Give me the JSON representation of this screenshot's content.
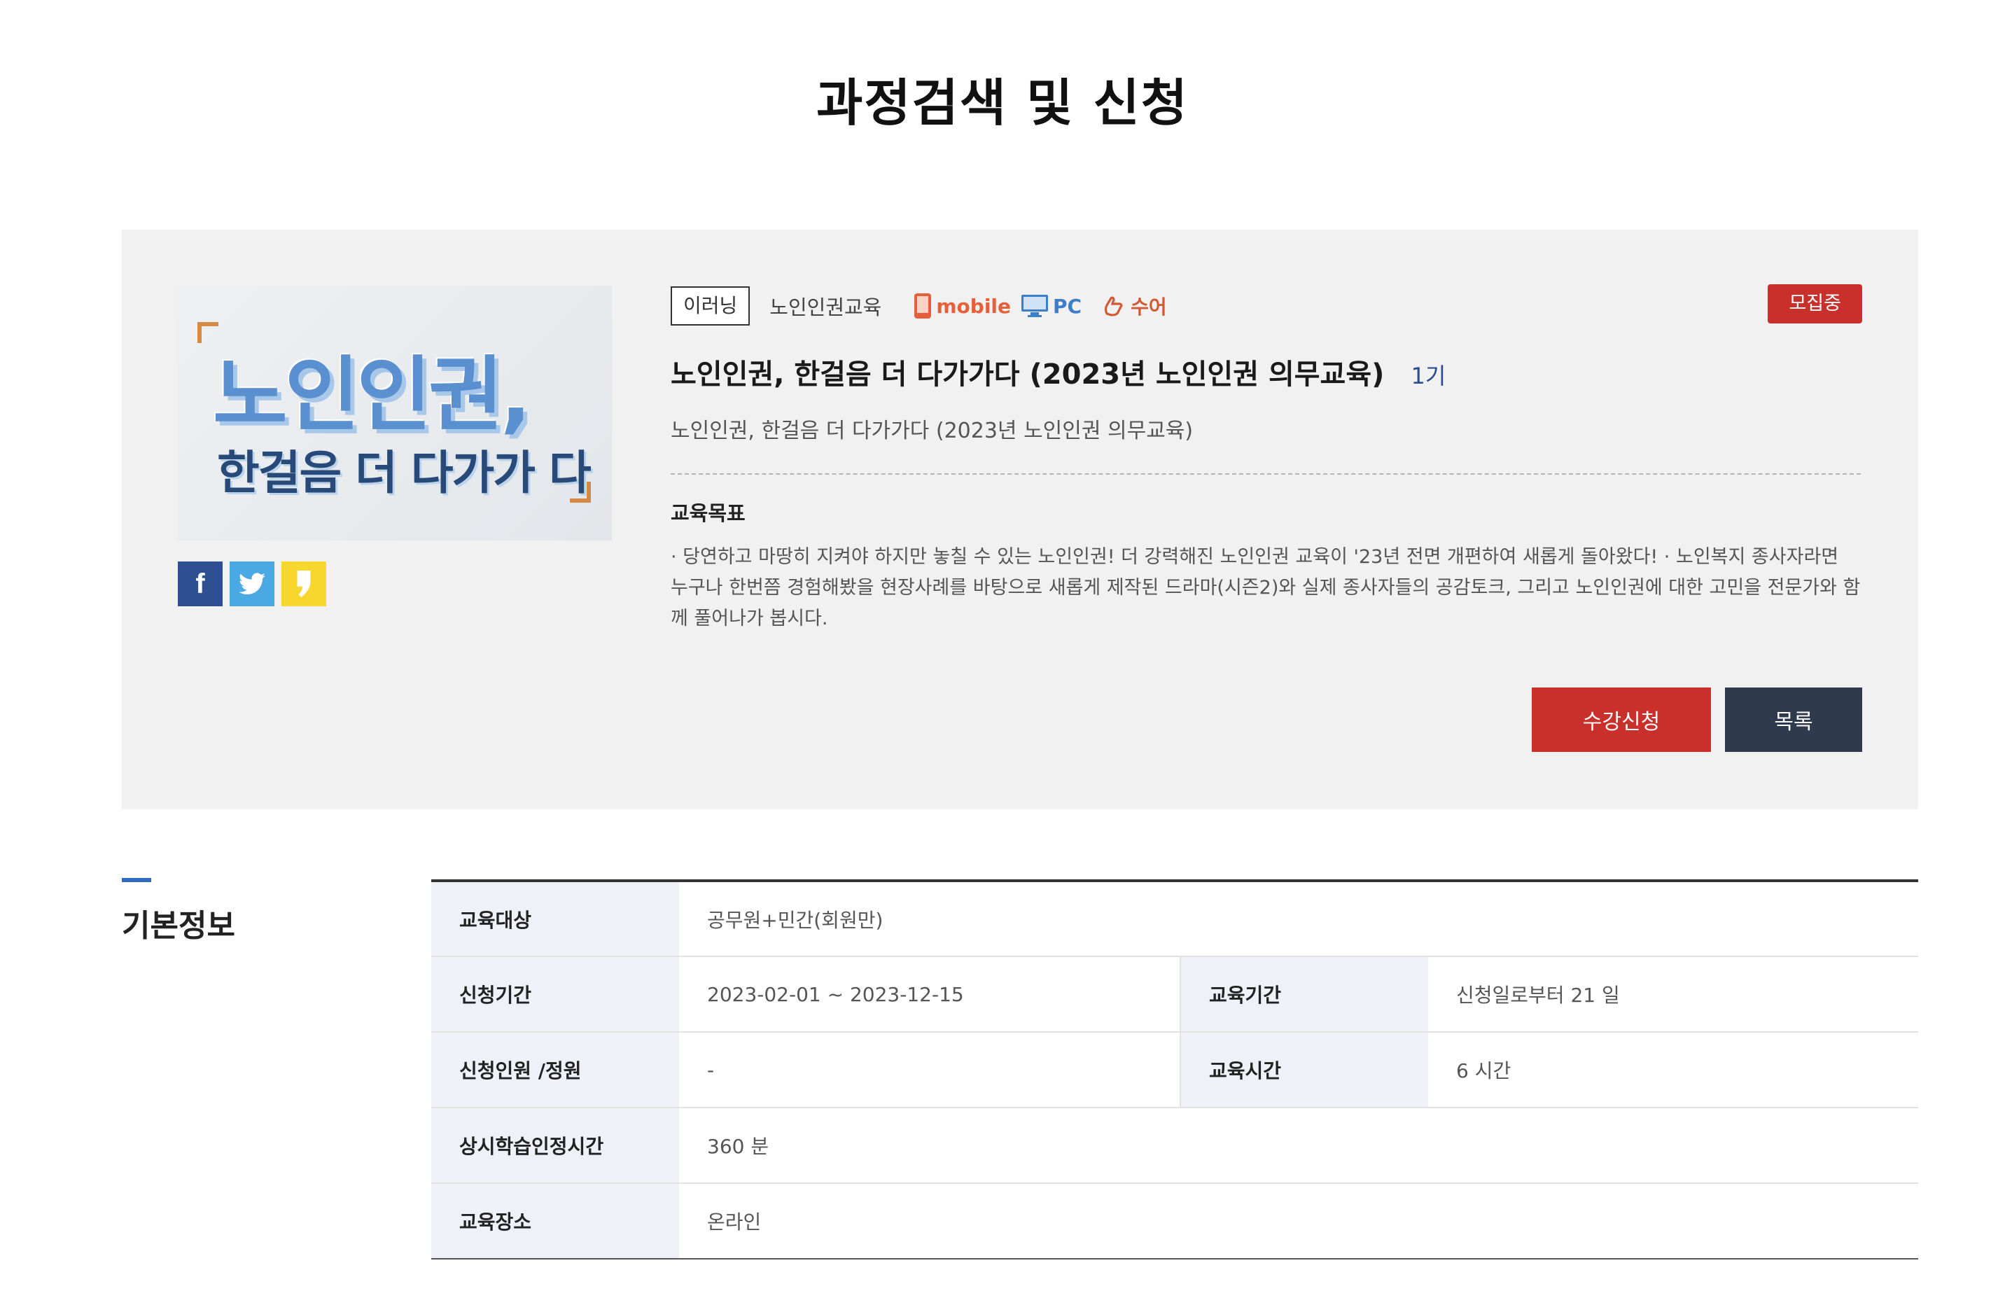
{
  "page": {
    "title": "과정검색 및 신청"
  },
  "course": {
    "thumbnail": {
      "line1": "노인인권,",
      "line2": "한걸음 더 다가가 다"
    },
    "share": {
      "facebook": "f",
      "twitter": "🐦",
      "kakao": "❜"
    },
    "status": "모집중",
    "type_tag": "이러닝",
    "category": "노인인권교육",
    "devices": {
      "mobile": "mobile",
      "pc": "PC",
      "sign": "수어"
    },
    "title": "노인인권, 한걸음 더 다가가다 (2023년 노인인권 의무교육)",
    "term": "1기",
    "subtitle": "노인인권, 한걸음 더 다가가다 (2023년 노인인권 의무교육)",
    "goal_heading": "교육목표",
    "goal_text": "· 당연하고 마땅히 지켜야 하지만 놓칠 수 있는 노인인권! 더 강력해진 노인인권 교육이 '23년 전면 개편하여 새롭게 돌아왔다! · 노인복지 종사자라면 누구나 한번쯤 경험해봤을 현장사례를 바탕으로 새롭게 제작된 드라마(시즌2)와 실제 종사자들의 공감토크, 그리고 노인인권에 대한 고민을 전문가와 함께 풀어나가 봅시다.",
    "buttons": {
      "apply": "수강신청",
      "list": "목록"
    }
  },
  "basic_info": {
    "section_title": "기본정보",
    "target_label": "교육대상",
    "target_value": "공무원+민간(회원만)",
    "apply_period_label": "신청기간",
    "apply_period_value": "2023-02-01 ~ 2023-12-15",
    "edu_period_label": "교육기간",
    "edu_period_value": "신청일로부터 21 일",
    "capacity_label": "신청인원 /정원",
    "capacity_value": "-",
    "edu_hours_label": "교육시간",
    "edu_hours_value": "6 시간",
    "recog_label": "상시학습인정시간",
    "recog_value": "360 분",
    "place_label": "교육장소",
    "place_value": "온라인"
  },
  "colors": {
    "accent_red": "#c9302c",
    "dark_button": "#303a4e",
    "header_cell": "#eef2f8",
    "section_mark": "#2f6bbf"
  }
}
